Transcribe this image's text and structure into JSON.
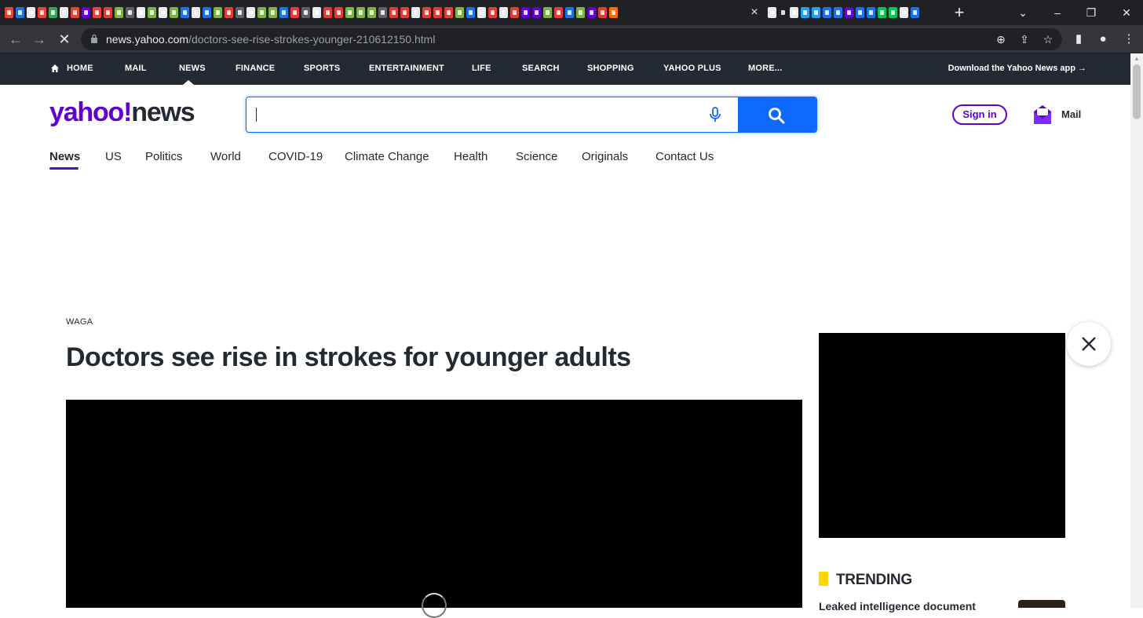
{
  "browser": {
    "tab_favicon_colors": [
      "#ea4335",
      "#1a73e8",
      "#e8eaed",
      "#ea4335",
      "#34a853",
      "#e8eaed",
      "#ea4335",
      "#6001d2",
      "#ea4335",
      "#e53935",
      "#7cb342",
      "#5f6368",
      "#e8eaed",
      "#7cb342",
      "#e8eaed",
      "#7cb342",
      "#1a73e8",
      "#e8eaed",
      "#1a73e8",
      "#7cb342",
      "#e53935",
      "#5f6368",
      "#e8eaed",
      "#7cb342",
      "#7cb342",
      "#1a73e8",
      "#e53935",
      "#5f6368",
      "#e8eaed",
      "#e53935",
      "#e53935",
      "#7cb342",
      "#7cb342",
      "#7cb342",
      "#5f6368",
      "#e53935",
      "#e53935",
      "#e8eaed",
      "#e53935",
      "#e53935",
      "#e53935",
      "#7cb342",
      "#1a73e8",
      "#e8eaed",
      "#e53935",
      "#e8eaed",
      "#e53935",
      "#6001d2",
      "#6001d2",
      "#7cb342",
      "#e53935",
      "#1a73e8",
      "#7cb342",
      "#6001d2",
      "#e53935",
      "#ff6d00"
    ],
    "tab_favicon_colors_right": [
      "#e8eaed",
      "#202124",
      "#e8eaed",
      "#1da1f2",
      "#1da1f2",
      "#1a73e8",
      "#1a73e8",
      "#6001d2",
      "#1a73e8",
      "#1a73e8",
      "#00c853",
      "#00c853",
      "#e8eaed",
      "#1a73e8"
    ],
    "active_tab_close": "×",
    "new_tab": "+",
    "window_controls": {
      "minimize": "–",
      "maximize": "❐",
      "close": "✕",
      "tab_search": "⌄"
    },
    "nav": {
      "back": "←",
      "forward": "→",
      "stop": "✕"
    },
    "url_host": "news.yahoo.com",
    "url_path": "/doctors-see-rise-strokes-younger-210612150.html",
    "omnibox_icons": {
      "zoom": "⊕",
      "share": "⇪",
      "bookmark": "☆"
    },
    "toolbar_icons": {
      "sidepanel": "▮",
      "profile": "●",
      "menu": "⋮"
    }
  },
  "yahoo_nav": {
    "items": [
      {
        "label": "HOME"
      },
      {
        "label": "MAIL"
      },
      {
        "label": "NEWS"
      },
      {
        "label": "FINANCE"
      },
      {
        "label": "SPORTS"
      },
      {
        "label": "ENTERTAINMENT"
      },
      {
        "label": "LIFE"
      },
      {
        "label": "SEARCH"
      },
      {
        "label": "SHOPPING"
      },
      {
        "label": "YAHOO PLUS"
      },
      {
        "label": "MORE..."
      }
    ],
    "active": "NEWS",
    "app_promo": "Download the Yahoo News app",
    "app_promo_arrow": "→"
  },
  "header": {
    "logo_brand": "yahoo!",
    "logo_section": "news",
    "search_value": "",
    "sign_in": "Sign in",
    "mail": "Mail"
  },
  "section_nav": {
    "items": [
      {
        "label": "News"
      },
      {
        "label": "US"
      },
      {
        "label": "Politics"
      },
      {
        "label": "World"
      },
      {
        "label": "COVID-19"
      },
      {
        "label": "Climate Change"
      },
      {
        "label": "Health"
      },
      {
        "label": "Science"
      },
      {
        "label": "Originals"
      },
      {
        "label": "Contact Us"
      }
    ],
    "active": "News"
  },
  "article": {
    "source": "WAGA",
    "headline": "Doctors see rise in strokes for younger adults"
  },
  "sidebar": {
    "trending_title": "TRENDING",
    "trending_items": [
      {
        "title": "Leaked intelligence document"
      }
    ]
  },
  "colors": {
    "yahoo_purple": "#6001d2",
    "search_blue": "#0f69ff",
    "nav_dark": "#232a31",
    "trending_yellow": "#ffd700"
  }
}
